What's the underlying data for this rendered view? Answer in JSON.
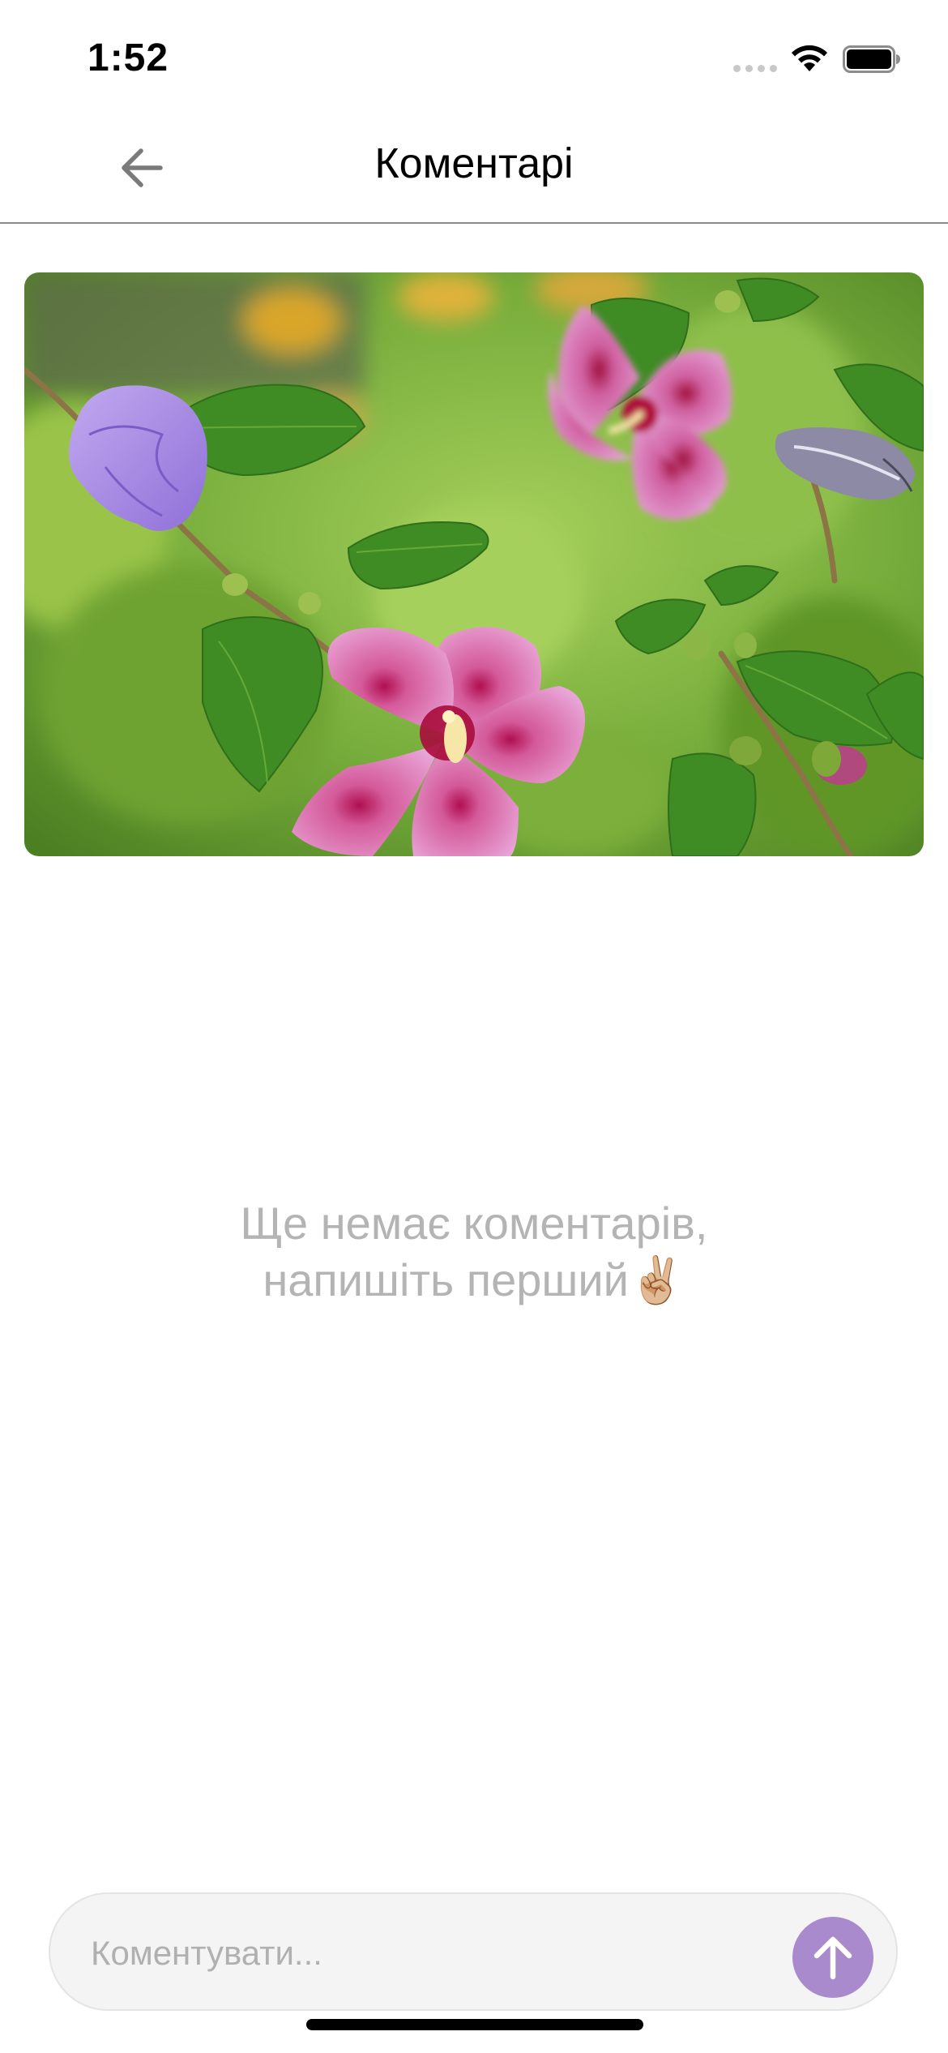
{
  "status_bar": {
    "time": "1:52"
  },
  "header": {
    "title": "Коментарі",
    "back_icon": "arrow-left-icon"
  },
  "post": {
    "image_description": "photo-hibiscus-flowers"
  },
  "empty_state": {
    "line1": "Ще немає коментарів,",
    "line2": "напишіть перший✌🏼"
  },
  "composer": {
    "placeholder": "Коментувати...",
    "send_icon": "arrow-up-icon"
  },
  "colors": {
    "accent": "#a98bcd",
    "muted_text": "#b4b4b4",
    "input_bg": "#f4f4f4"
  }
}
